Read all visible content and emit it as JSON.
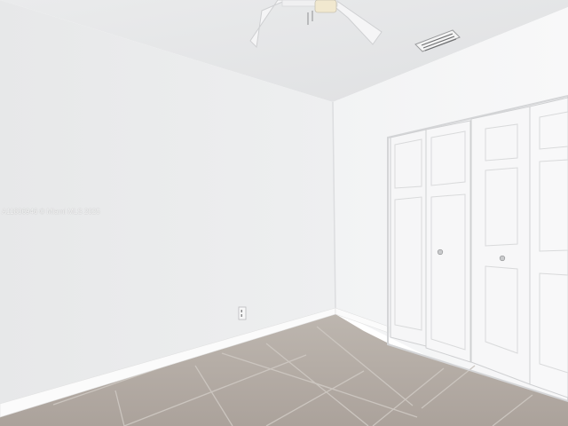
{
  "photo": {
    "watermark": "A11836946 © Miami MLS 2025"
  },
  "colors": {
    "ceiling": "#e6e7e8",
    "left_wall": "#eaebec",
    "back_wall": "#f0f1f2",
    "right_wall": "#f5f6f7",
    "closet_door": "#f6f6f7",
    "baseboard": "#fbfbfb",
    "floor_tile": "#b4aca5",
    "grout": "#c9c3bd"
  }
}
